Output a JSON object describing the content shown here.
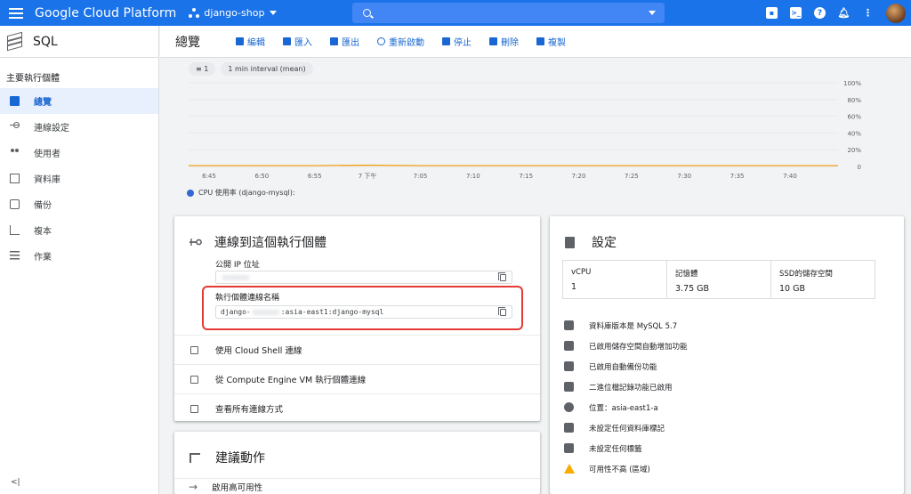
{
  "topbar": {
    "brand": "Google Cloud Platform",
    "project": "django-shop"
  },
  "sidebar": {
    "product": "SQL",
    "section_title": "主要執行個體",
    "items": [
      {
        "label": "總覽",
        "icon": "overview-icon",
        "active": true
      },
      {
        "label": "連線設定",
        "icon": "connection-icon",
        "active": false
      },
      {
        "label": "使用者",
        "icon": "users-icon",
        "active": false
      },
      {
        "label": "資料庫",
        "icon": "database-icon",
        "active": false
      },
      {
        "label": "備份",
        "icon": "backup-icon",
        "active": false
      },
      {
        "label": "複本",
        "icon": "replica-icon",
        "active": false
      },
      {
        "label": "作業",
        "icon": "operations-icon",
        "active": false
      }
    ],
    "collapse_label": "<|"
  },
  "toolbar": {
    "title": "總覽",
    "buttons": [
      {
        "label": "編輯",
        "icon": "edit-icon"
      },
      {
        "label": "匯入",
        "icon": "import-icon"
      },
      {
        "label": "匯出",
        "icon": "export-icon"
      },
      {
        "label": "重新啟動",
        "icon": "restart-icon"
      },
      {
        "label": "停止",
        "icon": "stop-icon"
      },
      {
        "label": "刪除",
        "icon": "delete-icon"
      },
      {
        "label": "複製",
        "icon": "clone-icon"
      }
    ]
  },
  "filters": {
    "filter_chip": "1",
    "interval_chip": "1 min interval (mean)"
  },
  "chart_data": {
    "type": "line",
    "x": [
      "6:45",
      "6:50",
      "6:55",
      "7 下午",
      "7:05",
      "7:10",
      "7:15",
      "7:20",
      "7:25",
      "7:30",
      "7:35",
      "7:40"
    ],
    "y_ticks": [
      "100%",
      "80%",
      "60%",
      "40%",
      "20%",
      "0"
    ],
    "ylim": [
      0,
      100
    ],
    "series": [
      {
        "name": "CPU 使用率 (django-mysql):",
        "color": "#3367d6",
        "values": [
          1,
          1,
          1,
          1.5,
          1,
          1,
          1,
          1,
          1,
          1,
          1,
          1
        ]
      }
    ],
    "line_color": "#f29900",
    "grid": true
  },
  "connect_card": {
    "title": "連線到這個執行個體",
    "public_ip_label": "公開 IP 位址",
    "conn_name_label": "執行個體連線名稱",
    "conn_name_prefix": "django-",
    "conn_name_suffix": ":asia-east1:django-mysql",
    "rows": [
      {
        "label": "使用 Cloud Shell 連線",
        "icon": "cloud-shell-icon"
      },
      {
        "label": "從 Compute Engine VM 執行個體連線",
        "icon": "chip-icon"
      },
      {
        "label": "查看所有連線方式",
        "icon": "external-link-icon"
      }
    ]
  },
  "settings_card": {
    "title": "設定",
    "stats": [
      {
        "key": "vCPU",
        "value": "1"
      },
      {
        "key": "記憶體",
        "value": "3.75 GB"
      },
      {
        "key": "SSD的儲存空間",
        "value": "10 GB"
      }
    ],
    "features": [
      {
        "text": "資料庫版本是 MySQL 5.7",
        "icon": "history-icon"
      },
      {
        "text": "已啟用儲存空間自動增加功能",
        "icon": "expand-icon"
      },
      {
        "text": "已啟用自動備份功能",
        "icon": "backup-icon"
      },
      {
        "text": "二進位檔記錄功能已啟用",
        "icon": "list-icon"
      },
      {
        "text": "位置：asia-east1-a",
        "icon": "globe-icon"
      },
      {
        "text": "未設定任何資料庫標記",
        "icon": "table-icon"
      },
      {
        "text": "未設定任何標籤",
        "icon": "label-icon"
      },
      {
        "text": "可用性不高 (區域)",
        "icon": "warning-icon"
      }
    ]
  },
  "reco_card": {
    "title": "建議動作",
    "row": "啟用高可用性"
  }
}
